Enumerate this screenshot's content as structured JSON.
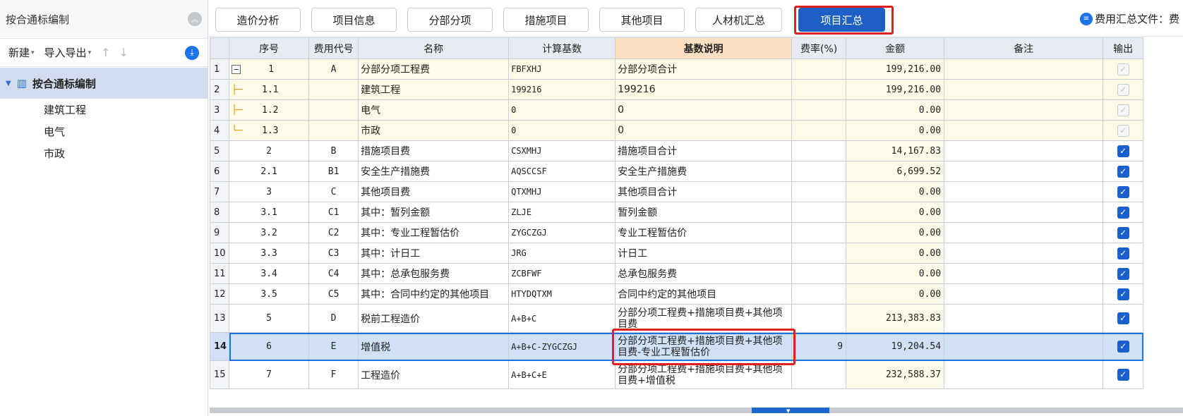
{
  "left_panel": {
    "title": "按合通标编制",
    "toolbar": {
      "new_label": "新建",
      "import_export_label": "导入导出"
    },
    "tree": {
      "root_label": "按合通标编制",
      "children": [
        "建筑工程",
        "电气",
        "市政"
      ]
    }
  },
  "tabs": [
    "造价分析",
    "项目信息",
    "分部分项",
    "措施项目",
    "其他项目",
    "人材机汇总",
    "项目汇总"
  ],
  "active_tab": "项目汇总",
  "summary_file_label": "费用汇总文件：费",
  "grid": {
    "headers": [
      "序号",
      "费用代号",
      "名称",
      "计算基数",
      "基数说明",
      "费率(%)",
      "金额",
      "备注",
      "输出"
    ],
    "rows": [
      {
        "rn": "1",
        "seq": "1",
        "code": "A",
        "name": "分部分项工程费",
        "base": "FBFXHJ",
        "desc": "分部分项合计",
        "rate": "",
        "amount": "199,216.00",
        "note": ""
      },
      {
        "rn": "2",
        "seq": "1.1",
        "code": "",
        "name": "建筑工程",
        "base": "199216",
        "desc": "199216",
        "rate": "",
        "amount": "199,216.00",
        "note": ""
      },
      {
        "rn": "3",
        "seq": "1.2",
        "code": "",
        "name": "电气",
        "base": "0",
        "desc": "0",
        "rate": "",
        "amount": "0.00",
        "note": ""
      },
      {
        "rn": "4",
        "seq": "1.3",
        "code": "",
        "name": "市政",
        "base": "0",
        "desc": "0",
        "rate": "",
        "amount": "0.00",
        "note": ""
      },
      {
        "rn": "5",
        "seq": "2",
        "code": "B",
        "name": "措施项目费",
        "base": "CSXMHJ",
        "desc": "措施项目合计",
        "rate": "",
        "amount": "14,167.83",
        "note": ""
      },
      {
        "rn": "6",
        "seq": "2.1",
        "code": "B1",
        "name": "安全生产措施费",
        "base": "AQSCCSF",
        "desc": "安全生产措施费",
        "rate": "",
        "amount": "6,699.52",
        "note": ""
      },
      {
        "rn": "7",
        "seq": "3",
        "code": "C",
        "name": "其他项目费",
        "base": "QTXMHJ",
        "desc": "其他项目合计",
        "rate": "",
        "amount": "0.00",
        "note": ""
      },
      {
        "rn": "8",
        "seq": "3.1",
        "code": "C1",
        "name": "其中：暂列金额",
        "base": "ZLJE",
        "desc": "暂列金额",
        "rate": "",
        "amount": "0.00",
        "note": ""
      },
      {
        "rn": "9",
        "seq": "3.2",
        "code": "C2",
        "name": "其中：专业工程暂估价",
        "base": "ZYGCZGJ",
        "desc": "专业工程暂估价",
        "rate": "",
        "amount": "0.00",
        "note": ""
      },
      {
        "rn": "10",
        "seq": "3.3",
        "code": "C3",
        "name": "其中：计日工",
        "base": "JRG",
        "desc": "计日工",
        "rate": "",
        "amount": "0.00",
        "note": ""
      },
      {
        "rn": "11",
        "seq": "3.4",
        "code": "C4",
        "name": "其中：总承包服务费",
        "base": "ZCBFWF",
        "desc": "总承包服务费",
        "rate": "",
        "amount": "0.00",
        "note": ""
      },
      {
        "rn": "12",
        "seq": "3.5",
        "code": "C5",
        "name": "其中：合同中约定的其他项目",
        "base": "HTYDQTXM",
        "desc": "合同中约定的其他项目",
        "rate": "",
        "amount": "0.00",
        "note": ""
      },
      {
        "rn": "13",
        "seq": "5",
        "code": "D",
        "name": "税前工程造价",
        "base": "A+B+C",
        "desc": "分部分项工程费+措施项目费+其他项目费",
        "rate": "",
        "amount": "213,383.83",
        "note": ""
      },
      {
        "rn": "14",
        "seq": "6",
        "code": "E",
        "name": "增值税",
        "base": "A+B+C-ZYGCZGJ",
        "desc": "分部分项工程费+措施项目费+其他项目费-专业工程暂估价",
        "rate": "9",
        "amount": "19,204.54",
        "note": ""
      },
      {
        "rn": "15",
        "seq": "7",
        "code": "F",
        "name": "工程造价",
        "base": "A+B+C+E",
        "desc": "分部分项工程费+措施项目费+其他项目费+增值税",
        "rate": "",
        "amount": "232,588.37",
        "note": ""
      }
    ]
  },
  "icons": {
    "collapse": "double-chevron-up-icon",
    "download": "download-circle-icon",
    "building": "building-icon",
    "info": "document-info-icon",
    "checkbox": "checkmark-icon"
  },
  "colors": {
    "accent": "#1e5fc3",
    "highlight_border": "#e02020",
    "selected_row": "#cfe0f7",
    "header_bg": "#e7ecf4",
    "selected_header_bg": "#fde0c2",
    "amount_bg": "#fdfbe8"
  }
}
